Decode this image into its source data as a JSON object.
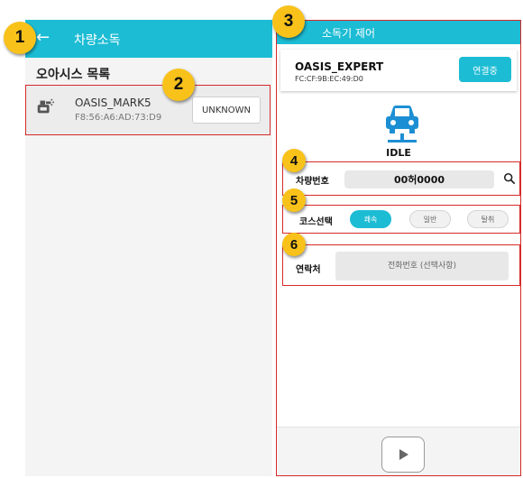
{
  "badges": [
    "1",
    "2",
    "3",
    "4",
    "5",
    "6"
  ],
  "left_screen": {
    "title": "차량소독",
    "list_heading": "오아시스 목록",
    "device": {
      "name": "OASIS_MARK5",
      "mac": "F8:56:A6:AD:73:D9",
      "status_button": "UNKNOWN"
    }
  },
  "right_screen": {
    "title": "소독기 제어",
    "connected_device": {
      "name": "OASIS_EXPERT",
      "mac": "FC:CF:9B:EC:49:D0",
      "connect_button": "연결중"
    },
    "status": "IDLE",
    "plate": {
      "label": "차량번호",
      "value": "00허0000"
    },
    "course": {
      "label": "코스선택",
      "options": [
        "쾌속",
        "일반",
        "탈취"
      ],
      "selected": "쾌속"
    },
    "contact": {
      "label": "연락처",
      "placeholder": "전화번호 (선택사항)"
    }
  },
  "colors": {
    "accent": "#1cbcd4",
    "highlight_border": "#d62a2a",
    "badge": "#f8c21a"
  }
}
